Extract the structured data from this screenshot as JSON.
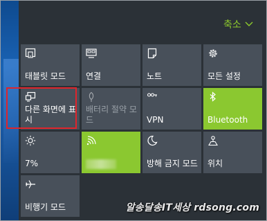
{
  "header": {
    "collapse_label": "축소",
    "accent": "#8bc830"
  },
  "tiles": [
    {
      "name": "tablet-mode",
      "label": "태블릿 모드",
      "icon": "tablet-mode-icon",
      "state": "off"
    },
    {
      "name": "connect",
      "label": "연결",
      "icon": "connect-icon",
      "state": "off"
    },
    {
      "name": "note",
      "label": "노트",
      "icon": "note-icon",
      "state": "off"
    },
    {
      "name": "all-settings",
      "label": "모든 설정",
      "icon": "gear-icon",
      "state": "off"
    },
    {
      "name": "project",
      "label": "다른 화면에 표시",
      "icon": "project-icon",
      "state": "off"
    },
    {
      "name": "battery-saver",
      "label": "배터리 절약 모드",
      "icon": "battery-saver-icon",
      "state": "disabled"
    },
    {
      "name": "vpn",
      "label": "VPN",
      "icon": "vpn-icon",
      "state": "off"
    },
    {
      "name": "bluetooth",
      "label": "Bluetooth",
      "icon": "bluetooth-icon",
      "state": "on"
    },
    {
      "name": "brightness",
      "label": "7%",
      "icon": "brightness-icon",
      "state": "off"
    },
    {
      "name": "wifi",
      "label": "",
      "icon": "wifi-icon",
      "state": "on"
    },
    {
      "name": "quiet-hours",
      "label": "방해 금지 모드",
      "icon": "moon-icon",
      "state": "off"
    },
    {
      "name": "location",
      "label": "위치",
      "icon": "location-icon",
      "state": "off"
    },
    {
      "name": "airplane-mode",
      "label": "비행기 모드",
      "icon": "airplane-icon",
      "state": "off"
    }
  ],
  "watermark": "알송달송IT세상 rdsong.com",
  "colors": {
    "tile_off": "#48505a",
    "tile_on": "#8bc830",
    "panel": "#2b3137",
    "highlight": "#e0242b"
  }
}
